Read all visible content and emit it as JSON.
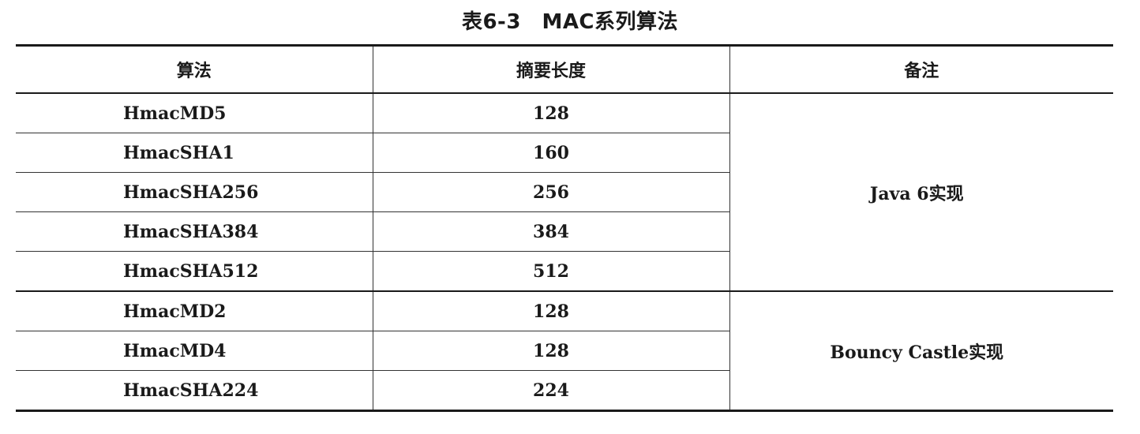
{
  "caption": "表6-3　MAC系列算法",
  "headers": {
    "algorithm": "算法",
    "digest_length": "摘要长度",
    "note": "备注"
  },
  "rows": [
    {
      "algorithm": "HmacMD5",
      "digest_length": "128"
    },
    {
      "algorithm": "HmacSHA1",
      "digest_length": "160"
    },
    {
      "algorithm": "HmacSHA256",
      "digest_length": "256"
    },
    {
      "algorithm": "HmacSHA384",
      "digest_length": "384"
    },
    {
      "algorithm": "HmacSHA512",
      "digest_length": "512"
    },
    {
      "algorithm": "HmacMD2",
      "digest_length": "128"
    },
    {
      "algorithm": "HmacMD4",
      "digest_length": "128"
    },
    {
      "algorithm": "HmacSHA224",
      "digest_length": "224"
    }
  ],
  "groups": [
    {
      "note": "Java 6实现"
    },
    {
      "note": "Bouncy Castle实现"
    }
  ]
}
